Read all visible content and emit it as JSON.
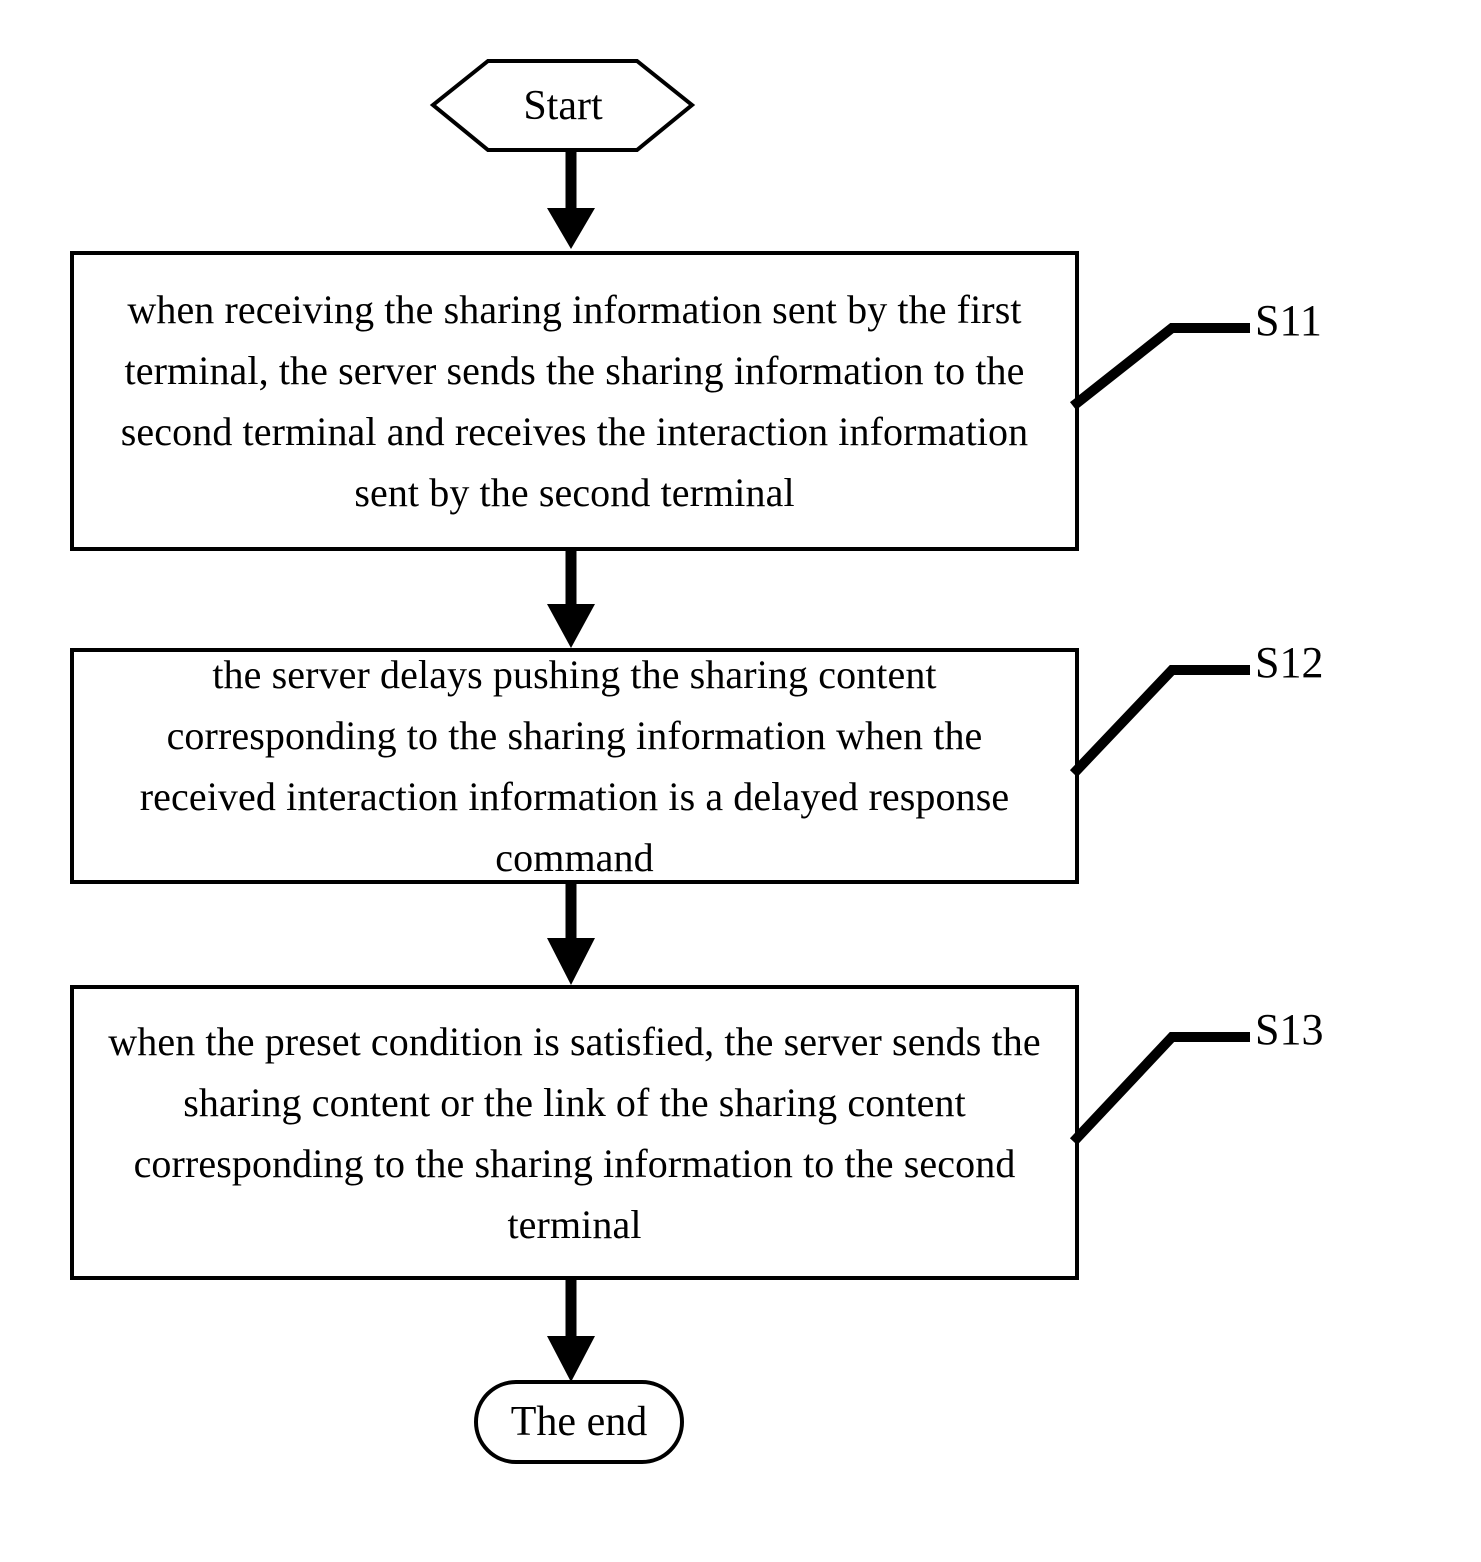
{
  "diagram": {
    "title": "flowchart",
    "type": "flowchart",
    "background_color": "#ffffff",
    "stroke_color": "#000000",
    "text_color": "#000000",
    "nodes": [
      {
        "id": "start",
        "shape": "hexagon",
        "label": "Start"
      },
      {
        "id": "s11",
        "shape": "rectangle",
        "label": "when receiving the sharing information sent by the first terminal, the server sends the sharing information to the second terminal and receives the interaction information sent by the second terminal",
        "step_label": "S11"
      },
      {
        "id": "s12",
        "shape": "rectangle",
        "label": "the server delays pushing the sharing content corresponding to the sharing information when the received interaction information is a delayed response command",
        "step_label": "S12"
      },
      {
        "id": "s13",
        "shape": "rectangle",
        "label": "when the preset condition is satisfied, the server sends the sharing content or the link of the sharing content corresponding to the sharing information to the second terminal",
        "step_label": "S13"
      },
      {
        "id": "end",
        "shape": "stadium",
        "label": "The end"
      }
    ],
    "connectors": [
      {
        "from": "start",
        "to": "s11",
        "style": "arrow-down"
      },
      {
        "from": "s11",
        "to": "s12",
        "style": "arrow-down"
      },
      {
        "from": "s12",
        "to": "s13",
        "style": "arrow-down"
      },
      {
        "from": "s13",
        "to": "end",
        "style": "arrow-down"
      }
    ],
    "leaders": [
      {
        "label": "S11",
        "from_node": "s11"
      },
      {
        "label": "S12",
        "from_node": "s12"
      },
      {
        "label": "S13",
        "from_node": "s13"
      }
    ]
  }
}
